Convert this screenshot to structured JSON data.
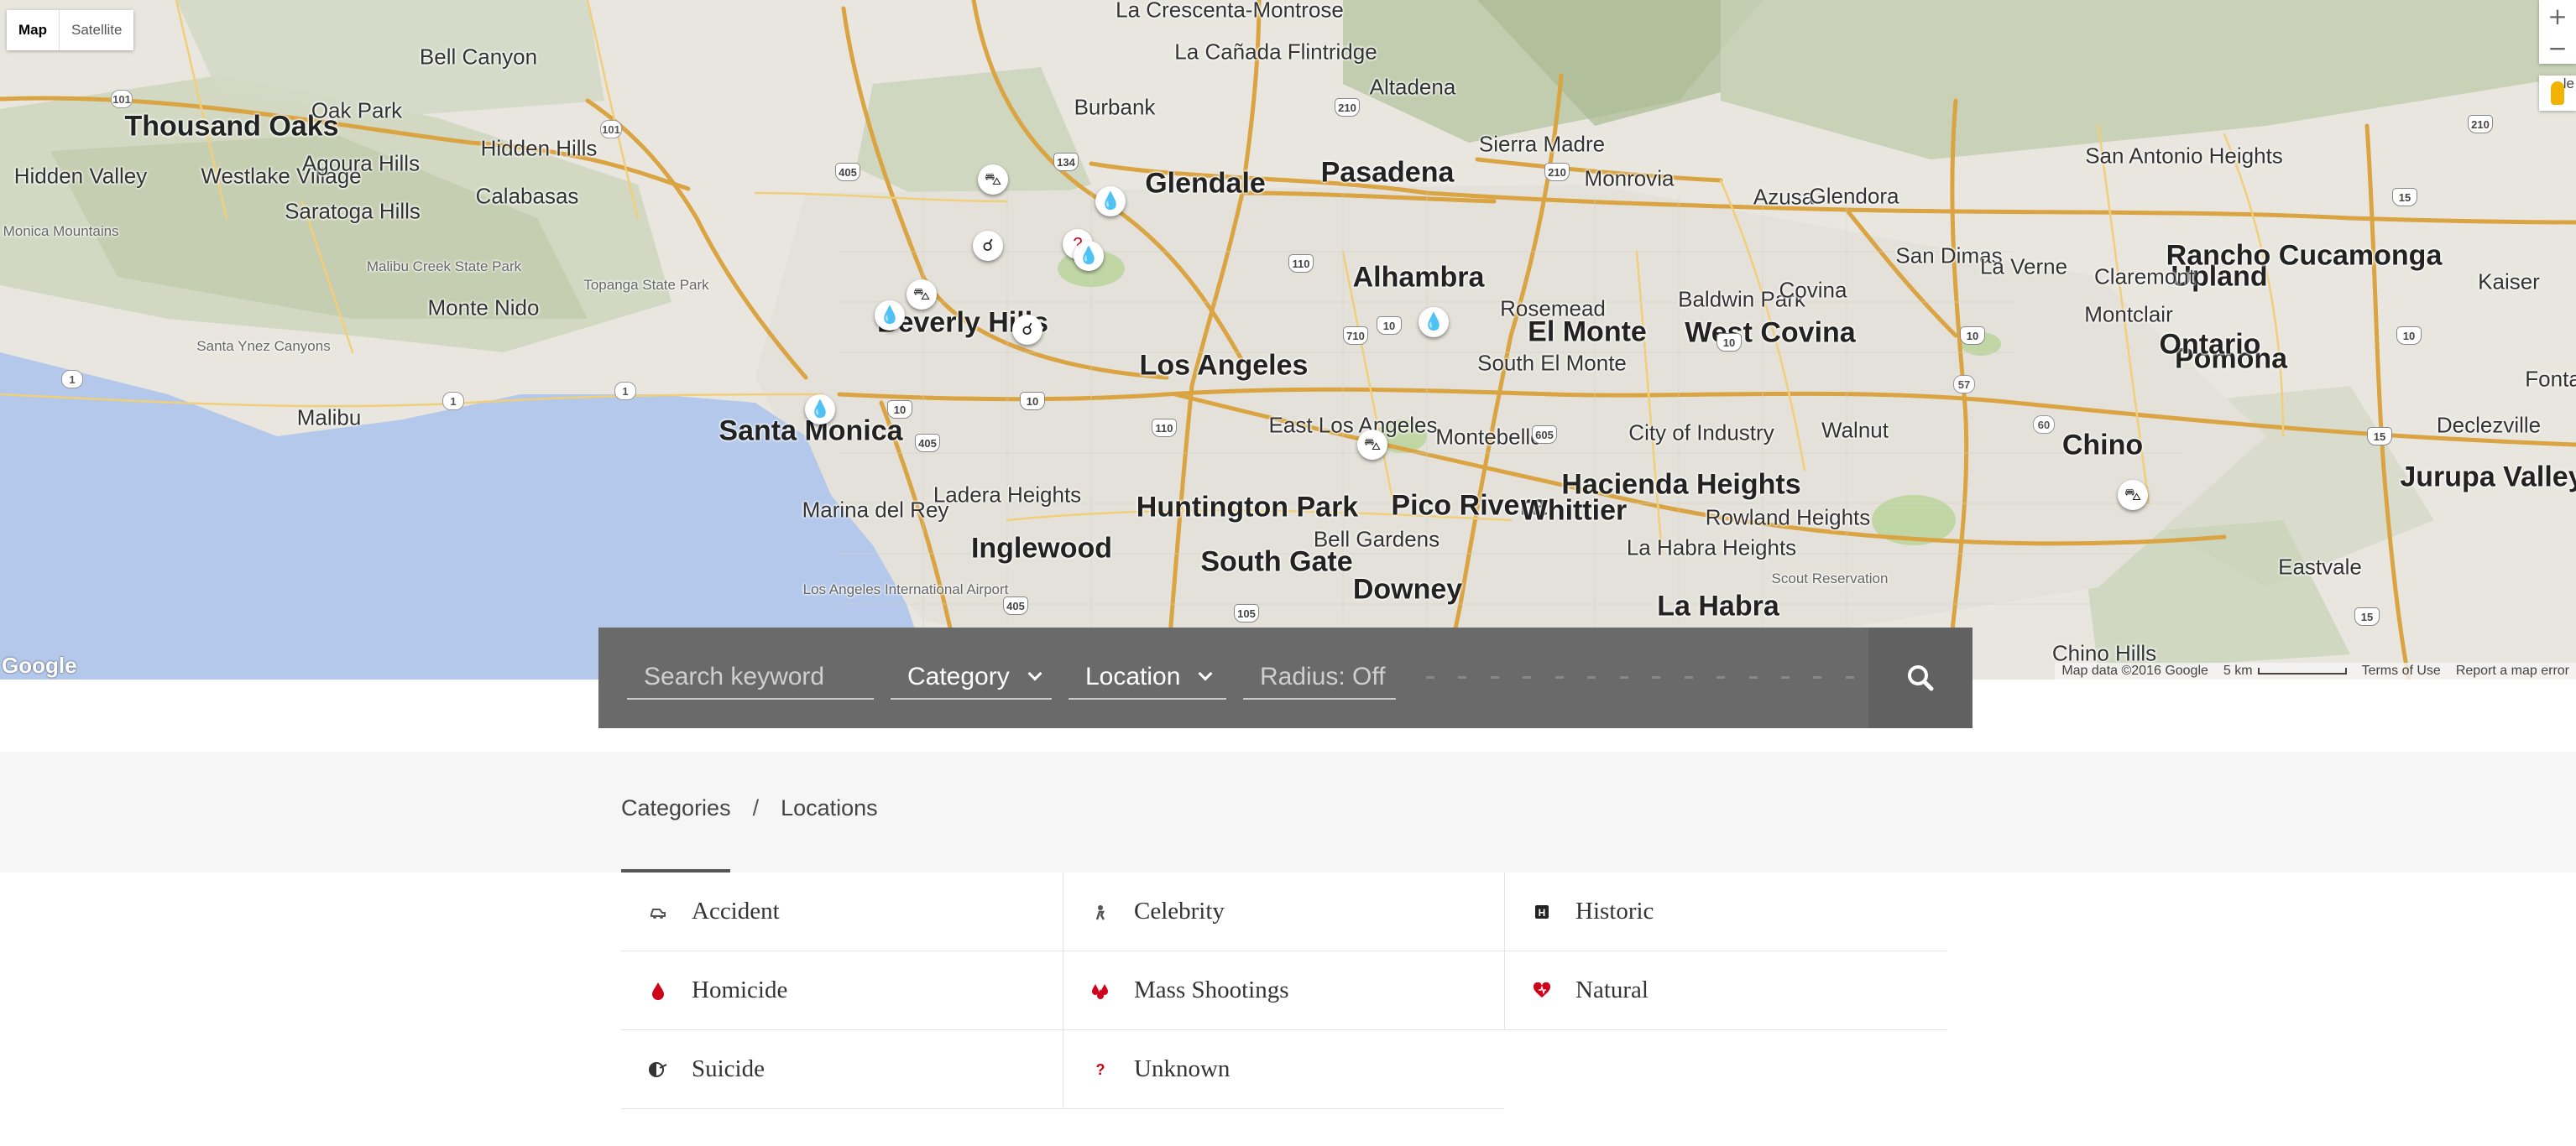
{
  "map": {
    "type_buttons": [
      "Map",
      "Satellite"
    ],
    "active_type": "Map",
    "zoom_in": "+",
    "zoom_out": "−",
    "edge_label": "le",
    "google_logo": "Google",
    "attribution": {
      "map_data": "Map data ©2016 Google",
      "scale": "5 km",
      "terms": "Terms of Use",
      "report": "Report a map error"
    },
    "places": [
      {
        "name": "La Crescenta-Montrose",
        "cls": "city"
      },
      {
        "name": "La Cañada Flintridge",
        "cls": "city"
      },
      {
        "name": "Altadena",
        "cls": "city"
      },
      {
        "name": "Sierra Madre",
        "cls": "city"
      },
      {
        "name": "San Antonio Heights",
        "cls": "city"
      },
      {
        "name": "Bell Canyon",
        "cls": "city"
      },
      {
        "name": "Thousand Oaks",
        "cls": "big"
      },
      {
        "name": "Oak Park",
        "cls": "city"
      },
      {
        "name": "Hidden Hills",
        "cls": "city"
      },
      {
        "name": "Burbank",
        "cls": "city"
      },
      {
        "name": "Glendale",
        "cls": "big"
      },
      {
        "name": "Pasadena",
        "cls": "big"
      },
      {
        "name": "Monrovia",
        "cls": "city"
      },
      {
        "name": "Azusa",
        "cls": "city"
      },
      {
        "name": "Glendora",
        "cls": "city"
      },
      {
        "name": "Hidden Valley",
        "cls": "city"
      },
      {
        "name": "Westlake Village",
        "cls": "city"
      },
      {
        "name": "Agoura Hills",
        "cls": "city"
      },
      {
        "name": "Calabasas",
        "cls": "city"
      },
      {
        "name": "Upland",
        "cls": "big"
      },
      {
        "name": "Rancho Cucamonga",
        "cls": "big"
      },
      {
        "name": "Saratoga Hills",
        "cls": "city"
      },
      {
        "name": "Santa Monica Mountains",
        "cls": "small"
      },
      {
        "name": "Malibu Creek State Park",
        "cls": "small"
      },
      {
        "name": "Topanga State Park",
        "cls": "small"
      },
      {
        "name": "Alhambra",
        "cls": "big"
      },
      {
        "name": "Baldwin Park",
        "cls": "city"
      },
      {
        "name": "Covina",
        "cls": "city"
      },
      {
        "name": "San Dimas",
        "cls": "city"
      },
      {
        "name": "La Verne",
        "cls": "city"
      },
      {
        "name": "Claremont",
        "cls": "city"
      },
      {
        "name": "Kaiser",
        "cls": "city"
      },
      {
        "name": "Monte Nido",
        "cls": "city"
      },
      {
        "name": "Beverly Hills",
        "cls": "big"
      },
      {
        "name": "Rosemead",
        "cls": "city"
      },
      {
        "name": "El Monte",
        "cls": "big"
      },
      {
        "name": "West Covina",
        "cls": "big"
      },
      {
        "name": "Montclair",
        "cls": "city"
      },
      {
        "name": "Pomona",
        "cls": "big"
      },
      {
        "name": "Ontario",
        "cls": "big"
      },
      {
        "name": "Fontana",
        "cls": "city"
      },
      {
        "name": "Santa Ynez Canyons",
        "cls": "small"
      },
      {
        "name": "Los Angeles",
        "cls": "big"
      },
      {
        "name": "South El Monte",
        "cls": "city"
      },
      {
        "name": "Malibu",
        "cls": "city"
      },
      {
        "name": "Santa Monica",
        "cls": "big"
      },
      {
        "name": "East Los Angeles",
        "cls": "city"
      },
      {
        "name": "Montebello",
        "cls": "city"
      },
      {
        "name": "City of Industry",
        "cls": "city"
      },
      {
        "name": "Walnut",
        "cls": "city"
      },
      {
        "name": "Chino",
        "cls": "big"
      },
      {
        "name": "Declezville",
        "cls": "city"
      },
      {
        "name": "Hacienda Heights",
        "cls": "big"
      },
      {
        "name": "Jurupa Valley",
        "cls": "big"
      },
      {
        "name": "Marina del Rey",
        "cls": "city"
      },
      {
        "name": "Ladera Heights",
        "cls": "city"
      },
      {
        "name": "Huntington Park",
        "cls": "big"
      },
      {
        "name": "Pico Rivera",
        "cls": "big"
      },
      {
        "name": "Whittier",
        "cls": "big"
      },
      {
        "name": "Rowland Heights",
        "cls": "city"
      },
      {
        "name": "Bell Gardens",
        "cls": "city"
      },
      {
        "name": "La Habra Heights",
        "cls": "city"
      },
      {
        "name": "Scout Reservation",
        "cls": "small"
      },
      {
        "name": "Eastvale",
        "cls": "city"
      },
      {
        "name": "Inglewood",
        "cls": "big"
      },
      {
        "name": "South Gate",
        "cls": "big"
      },
      {
        "name": "Downey",
        "cls": "big"
      },
      {
        "name": "Los Angeles International Airport",
        "cls": "small"
      },
      {
        "name": "La Habra",
        "cls": "big"
      },
      {
        "name": "Chino Hills",
        "cls": "city"
      }
    ],
    "markers": [
      {
        "kind": "dark",
        "glyph": "⛍"
      },
      {
        "kind": "drop",
        "glyph": "💧"
      },
      {
        "kind": "drop",
        "glyph": "?"
      },
      {
        "kind": "drop",
        "glyph": "💧"
      },
      {
        "kind": "dark",
        "glyph": "☌"
      },
      {
        "kind": "dark",
        "glyph": "⛍"
      },
      {
        "kind": "drop",
        "glyph": "💧"
      },
      {
        "kind": "dark",
        "glyph": "☌"
      },
      {
        "kind": "drop",
        "glyph": "💧"
      },
      {
        "kind": "drop",
        "glyph": "💧"
      },
      {
        "kind": "dark",
        "glyph": "⛍"
      },
      {
        "kind": "dark",
        "glyph": "⛍"
      }
    ]
  },
  "search": {
    "keyword_placeholder": "Search keyword",
    "category_label": "Category",
    "location_label": "Location",
    "radius_label": "Radius: Off",
    "button_icon": "search-icon"
  },
  "tabs": {
    "items": [
      "Categories",
      "Locations"
    ],
    "separator": "/",
    "active": "Categories"
  },
  "categories": [
    {
      "label": "Accident",
      "icon": "car-crash-icon",
      "color": "#555555"
    },
    {
      "label": "Celebrity",
      "icon": "star-figure-icon",
      "color": "#555555"
    },
    {
      "label": "Historic",
      "icon": "historic-marker-icon",
      "color": "#222222"
    },
    {
      "label": "Homicide",
      "icon": "blood-drop-icon",
      "color": "#d0021b"
    },
    {
      "label": "Mass Shootings",
      "icon": "mass-shooting-icon",
      "color": "#d0021b"
    },
    {
      "label": "Natural",
      "icon": "heart-icon",
      "color": "#d0021b"
    },
    {
      "label": "Suicide",
      "icon": "suicide-icon",
      "color": "#333333"
    },
    {
      "label": "Unknown",
      "icon": "question-mark-icon",
      "color": "#d0021b"
    }
  ]
}
